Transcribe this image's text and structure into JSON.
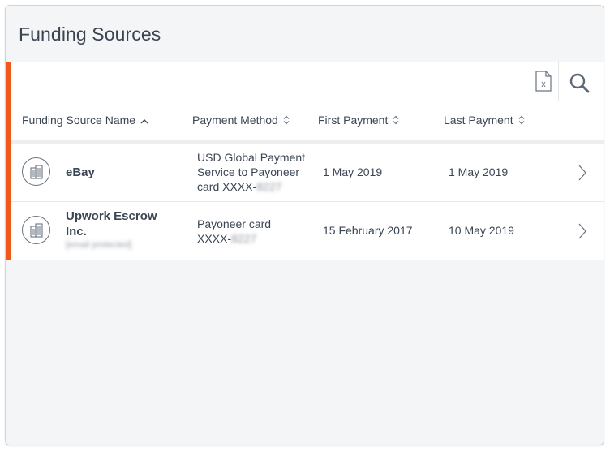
{
  "panel": {
    "title": "Funding Sources"
  },
  "toolbar": {
    "export_icon": "excel-export-icon",
    "search_icon": "search-icon"
  },
  "columns": [
    {
      "label": "Funding Source Name",
      "sort": "ascending"
    },
    {
      "label": "Payment Method",
      "sort": "unsorted"
    },
    {
      "label": "First Payment",
      "sort": "unsorted"
    },
    {
      "label": "Last Payment",
      "sort": "unsorted"
    }
  ],
  "rows": [
    {
      "name_line1": "eBay",
      "name_line2": "",
      "email_masked": "",
      "method_line1": "USD Global Payment",
      "method_line2": "Service to Payoneer",
      "method_line3": "card XXXX-",
      "method_masked": "8227",
      "first_payment": "1 May 2019",
      "last_payment": "1 May 2019"
    },
    {
      "name_line1": "Upwork Escrow",
      "name_line2": "Inc.",
      "email_masked": "[email protected]",
      "method_line1": "Payoneer card",
      "method_line2": "XXXX-",
      "method_line3": "",
      "method_masked": "8227",
      "first_payment": "15 February 2017",
      "last_payment": "10 May 2019"
    }
  ],
  "colors": {
    "accent": "#ef5a1c",
    "text": "#3b4654",
    "panel_bg": "#f4f5f7"
  }
}
